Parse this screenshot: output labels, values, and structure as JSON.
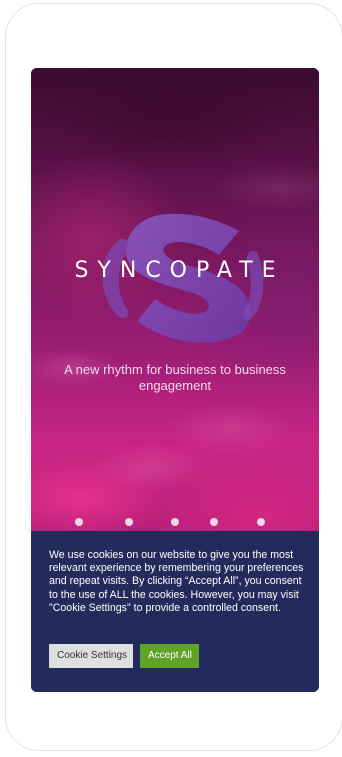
{
  "hero": {
    "brand": "SYNCOPATE",
    "tagline": "A new rhythm for business to business engagement",
    "slide_count": 5
  },
  "cookie_banner": {
    "message": "We use cookies on our website to give you the most relevant experience by remembering your preferences and repeat visits. By clicking “Accept All”, you consent to the use of ALL the cookies. However, you may visit \"Cookie Settings\" to provide a controlled consent.",
    "settings_label": "Cookie Settings",
    "accept_label": "Accept All"
  },
  "colors": {
    "banner_bg": "#222b5b",
    "accept_bg": "#61a229",
    "settings_bg": "#dedfe0",
    "hero_accent": "#c92585"
  },
  "icons": {
    "logo": "syncopate-s-logo-icon"
  }
}
